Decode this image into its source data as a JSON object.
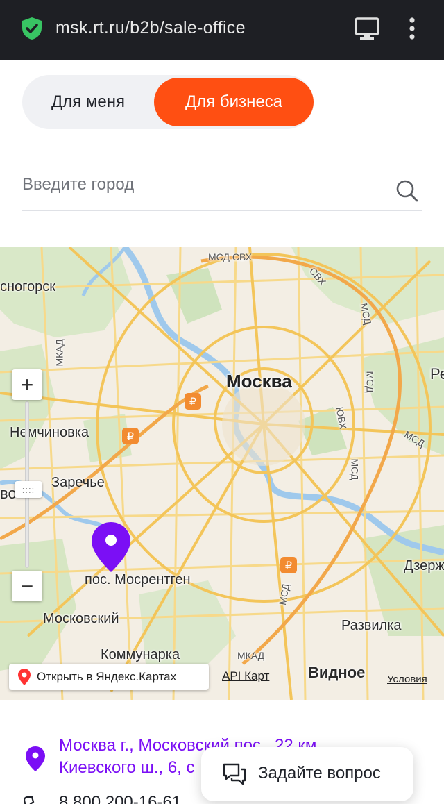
{
  "browser": {
    "url": "msk.rt.ru/b2b/sale-office"
  },
  "segments": {
    "personal": "Для меня",
    "business": "Для бизнеса"
  },
  "search": {
    "placeholder": "Введите город"
  },
  "map": {
    "labels": {
      "krasnogorsk": "сногорск",
      "moskva": "Москва",
      "nemchinovka": "Немчиновка",
      "zarechye": "Заречье",
      "mosrentgen": "пос. Мосрентген",
      "moskovsky": "Московский",
      "kommunarka": "Коммунарка",
      "vidnoe": "Видное",
      "razvilka": "Развилка",
      "dzerzh": "Дзерж",
      "edge_re": "Ре",
      "edge_vo": "во"
    },
    "roads": {
      "msd_svh_top": "МСД  СВХ",
      "svh_right": "СВХ",
      "mkad_left": "МКАД",
      "mkad_bottom": "МКАД",
      "msd_right": "МСД",
      "msd_right2": "МСД",
      "msd_far_right": "МСД",
      "msd_bottom": "МСД",
      "uvh": "ЮВХ",
      "msd_small": "МСД"
    },
    "zoom": {
      "plus": "+",
      "minus": "−",
      "thumb": "::::"
    },
    "open_in_yandex": "Открыть в Яндекс.Картах",
    "api": "API Карт",
    "terms": "Условия"
  },
  "office": {
    "address": "Москва г., Московский пос., 22 км Киевского ш., 6, с",
    "phone": "8 800 200-16-61"
  },
  "chat": {
    "label": "Задайте вопрос"
  },
  "colors": {
    "accent_orange": "#ff4f12",
    "brand_purple": "#7b0ff5",
    "browser_bar": "#1e1f24"
  }
}
